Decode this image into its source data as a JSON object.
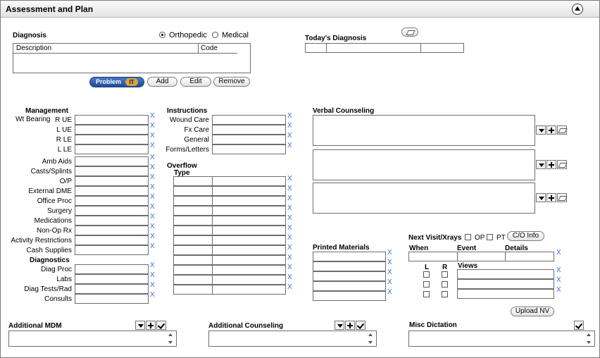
{
  "title": "Assessment and Plan",
  "diagnosis": {
    "label": "Diagnosis",
    "radio_orthopedic": "Orthopedic",
    "radio_medical": "Medical",
    "col_description": "Description",
    "col_code": "Code",
    "problem_it_prefix": "Problem",
    "problem_it_suffix": "IT",
    "add": "Add",
    "edit": "Edit",
    "remove": "Remove"
  },
  "todays_diagnosis": {
    "label": "Today's Diagnosis"
  },
  "management": {
    "label": "Management",
    "wt_bearing": "Wt Bearing",
    "rows": [
      "R UE",
      "L UE",
      "R LE",
      "L LE",
      "Amb Aids",
      "Casts/Splints",
      "O/P",
      "External DME",
      "Office Proc",
      "Surgery",
      "Medications",
      "Non-Op Rx",
      "Activity Restrictions",
      "Cash Supplies"
    ]
  },
  "diagnostics": {
    "label": "Diagnostics",
    "rows": [
      "Diag Proc",
      "Labs",
      "Diag Tests/Rad",
      "Consults"
    ]
  },
  "instructions": {
    "label": "Instructions",
    "rows": [
      "Wound Care",
      "Fx Care",
      "General",
      "Forms/Letters"
    ]
  },
  "overflow": {
    "label": "Overflow",
    "type_label": "Type"
  },
  "x_label": "X",
  "verbal_counseling": {
    "label": "Verbal Counseling"
  },
  "printed_materials": {
    "label": "Printed Materials"
  },
  "next_visit": {
    "label": "Next Visit/Xrays",
    "op": "OP",
    "pt": "PT",
    "co_info": "C/O Info",
    "when": "When",
    "event": "Event",
    "details": "Details",
    "l": "L",
    "r": "R",
    "views": "Views",
    "upload_nv": "Upload NV"
  },
  "additional_mdm": {
    "label": "Additional MDM"
  },
  "additional_counseling": {
    "label": "Additional Counseling"
  },
  "misc_dictation": {
    "label": "Misc Dictation"
  },
  "colors": {
    "link_x": "#3d6cd4",
    "problem_button": "#1f4c9a",
    "problem_it_badge": "#d9a441"
  }
}
